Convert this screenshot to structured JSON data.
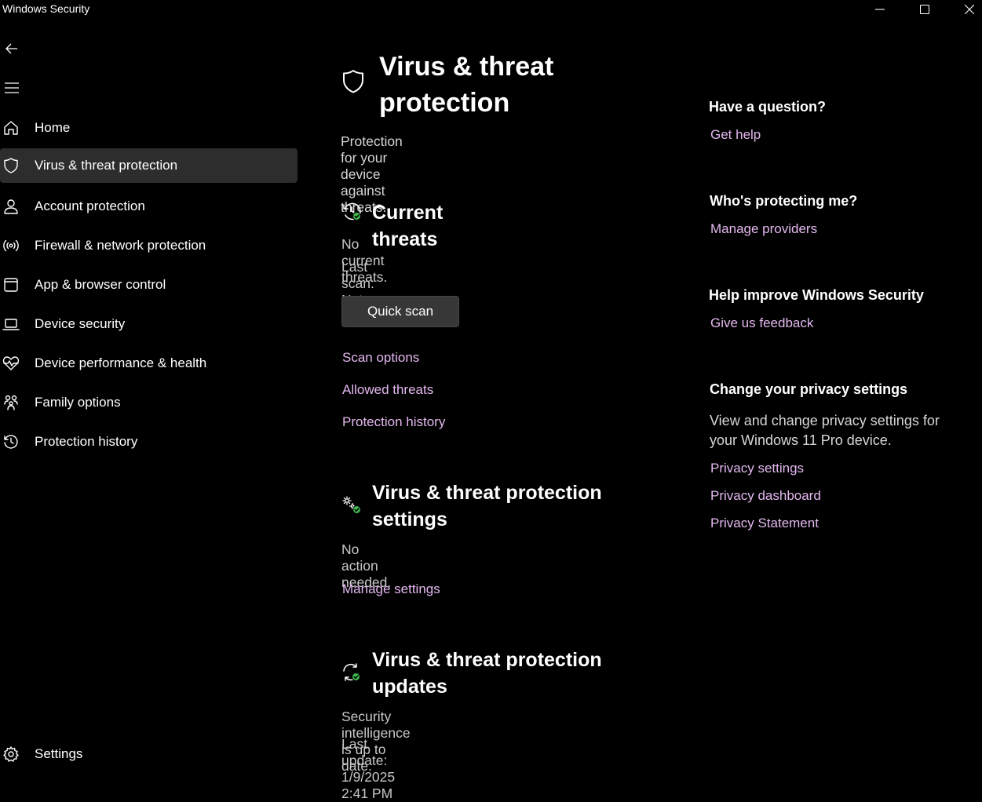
{
  "window": {
    "title": "Windows Security"
  },
  "sidebar": {
    "items": [
      {
        "label": "Home",
        "icon": "home-icon"
      },
      {
        "label": "Virus & threat protection",
        "icon": "shield-icon",
        "selected": true
      },
      {
        "label": "Account protection",
        "icon": "person-icon"
      },
      {
        "label": "Firewall & network protection",
        "icon": "antenna-icon"
      },
      {
        "label": "App & browser control",
        "icon": "app-window-icon"
      },
      {
        "label": "Device security",
        "icon": "laptop-icon"
      },
      {
        "label": "Device performance & health",
        "icon": "heartbeat-icon"
      },
      {
        "label": "Family options",
        "icon": "family-icon"
      },
      {
        "label": "Protection history",
        "icon": "history-icon"
      }
    ],
    "settings_label": "Settings"
  },
  "main": {
    "title": "Virus & threat protection",
    "subtitle": "Protection for your device against threats.",
    "current_threats": {
      "title": "Current threats",
      "status": "No current threats.",
      "last_scan": "Last scan: Not available",
      "quick_scan_label": "Quick scan",
      "links": [
        "Scan options",
        "Allowed threats",
        "Protection history"
      ]
    },
    "settings_section": {
      "title": "Virus & threat protection settings",
      "status": "No action needed.",
      "link": "Manage settings"
    },
    "updates_section": {
      "title": "Virus & threat protection updates",
      "status": "Security intelligence is up to date.",
      "last_update": "Last update: 1/9/2025 2:41 PM"
    }
  },
  "aside": {
    "question": {
      "heading": "Have a question?",
      "link": "Get help"
    },
    "protecting": {
      "heading": "Who's protecting me?",
      "link": "Manage providers"
    },
    "improve": {
      "heading": "Help improve Windows Security",
      "link": "Give us feedback"
    },
    "privacy": {
      "heading": "Change your privacy settings",
      "text": "View and change privacy settings for your Windows 11 Pro device.",
      "links": [
        "Privacy settings",
        "Privacy dashboard",
        "Privacy Statement"
      ]
    }
  },
  "colors": {
    "background": "#000000",
    "link": "#e4b8f0",
    "selected_item": "#2d2d2d",
    "status_ok": "#3fb950"
  }
}
